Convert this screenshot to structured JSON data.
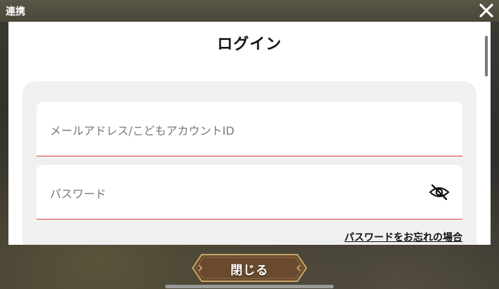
{
  "titlebar": {
    "title": "連携"
  },
  "dialog": {
    "title": "ログイン",
    "email_placeholder": "メールアドレス/こどもアカウントID",
    "password_placeholder": "パスワード",
    "forgot_link": "パスワードをお忘れの場合"
  },
  "footer": {
    "close_label": "閉じる"
  },
  "icons": {
    "close": "close-x-icon",
    "password_visibility": "eye-slash-icon"
  },
  "colors": {
    "field_underline": "#e0403a",
    "button_fill": "#6a4a2e",
    "button_border": "#c8a66a"
  }
}
